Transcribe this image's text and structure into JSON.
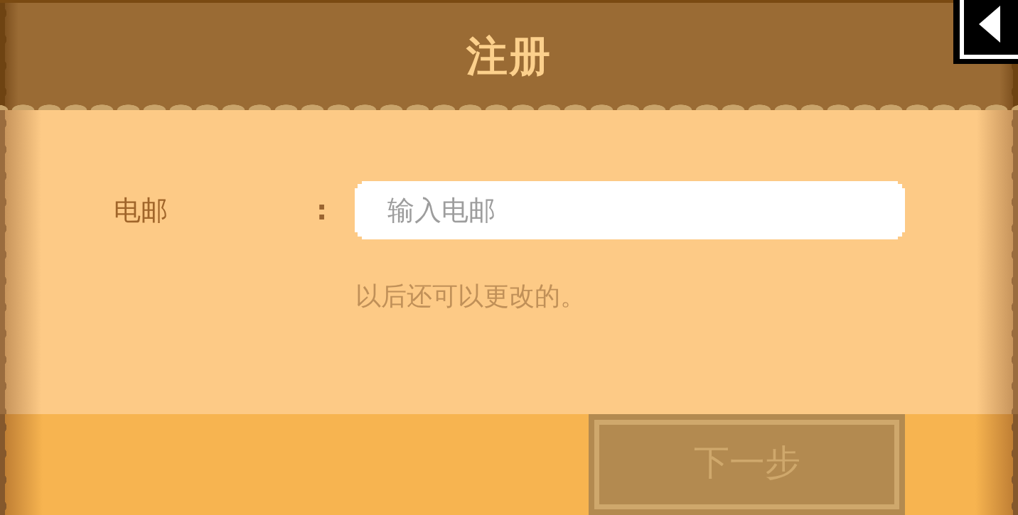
{
  "header": {
    "title": "注册"
  },
  "form": {
    "fields": [
      {
        "label": "电邮",
        "separator": ":",
        "placeholder": "输入电邮",
        "hint": "以后还可以更改的。"
      }
    ]
  },
  "footer": {
    "next_button": {
      "label": "下一步",
      "disabled": true
    }
  }
}
